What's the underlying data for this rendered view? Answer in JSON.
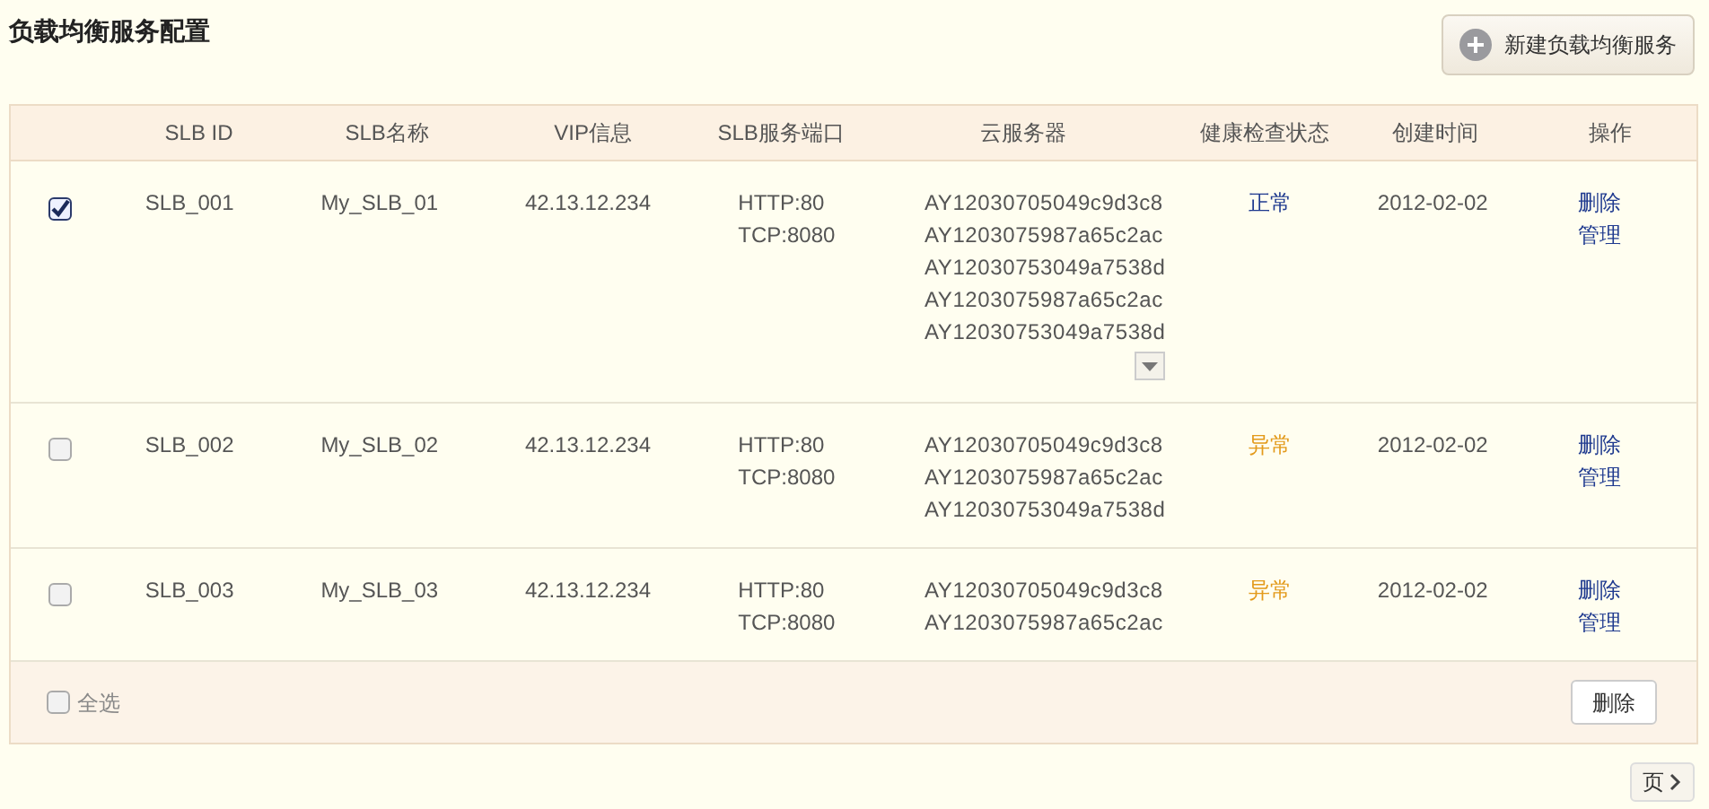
{
  "title": "负载均衡服务配置",
  "new_button": {
    "label": "新建负载均衡服务"
  },
  "table": {
    "columns": [
      "SLB ID",
      "SLB名称",
      "VIP信息",
      "SLB服务端口",
      "云服务器",
      "健康检查状态",
      "创建时间",
      "操作"
    ],
    "rows": [
      {
        "selected": true,
        "id": "SLB_001",
        "name": "My_SLB_01",
        "vip": "42.13.12.234",
        "ports": [
          "HTTP:80",
          "TCP:8080"
        ],
        "servers": [
          "AY12030705049c9d3c8",
          "AY1203075987a65c2ac",
          "AY12030753049a7538d",
          "AY1203075987a65c2ac",
          "AY12030753049a7538d"
        ],
        "more": true,
        "health": {
          "label": "正常",
          "kind": "normal"
        },
        "created": "2012-02-02",
        "actions": [
          "删除",
          "管理"
        ]
      },
      {
        "selected": false,
        "id": "SLB_002",
        "name": "My_SLB_02",
        "vip": "42.13.12.234",
        "ports": [
          "HTTP:80",
          "TCP:8080"
        ],
        "servers": [
          "AY12030705049c9d3c8",
          "AY1203075987a65c2ac",
          "AY12030753049a7538d"
        ],
        "more": false,
        "health": {
          "label": "异常",
          "kind": "abnormal"
        },
        "created": "2012-02-02",
        "actions": [
          "删除",
          "管理"
        ]
      },
      {
        "selected": false,
        "id": "SLB_003",
        "name": "My_SLB_03",
        "vip": "42.13.12.234",
        "ports": [
          "HTTP:80",
          "TCP:8080"
        ],
        "servers": [
          "AY12030705049c9d3c8",
          "AY1203075987a65c2ac"
        ],
        "more": false,
        "health": {
          "label": "异常",
          "kind": "abnormal"
        },
        "created": "2012-02-02",
        "actions": [
          "删除",
          "管理"
        ]
      }
    ]
  },
  "footer": {
    "select_all": {
      "label": "全选",
      "checked": false
    },
    "delete_button": "删除"
  },
  "pagination": {
    "next": "页"
  }
}
